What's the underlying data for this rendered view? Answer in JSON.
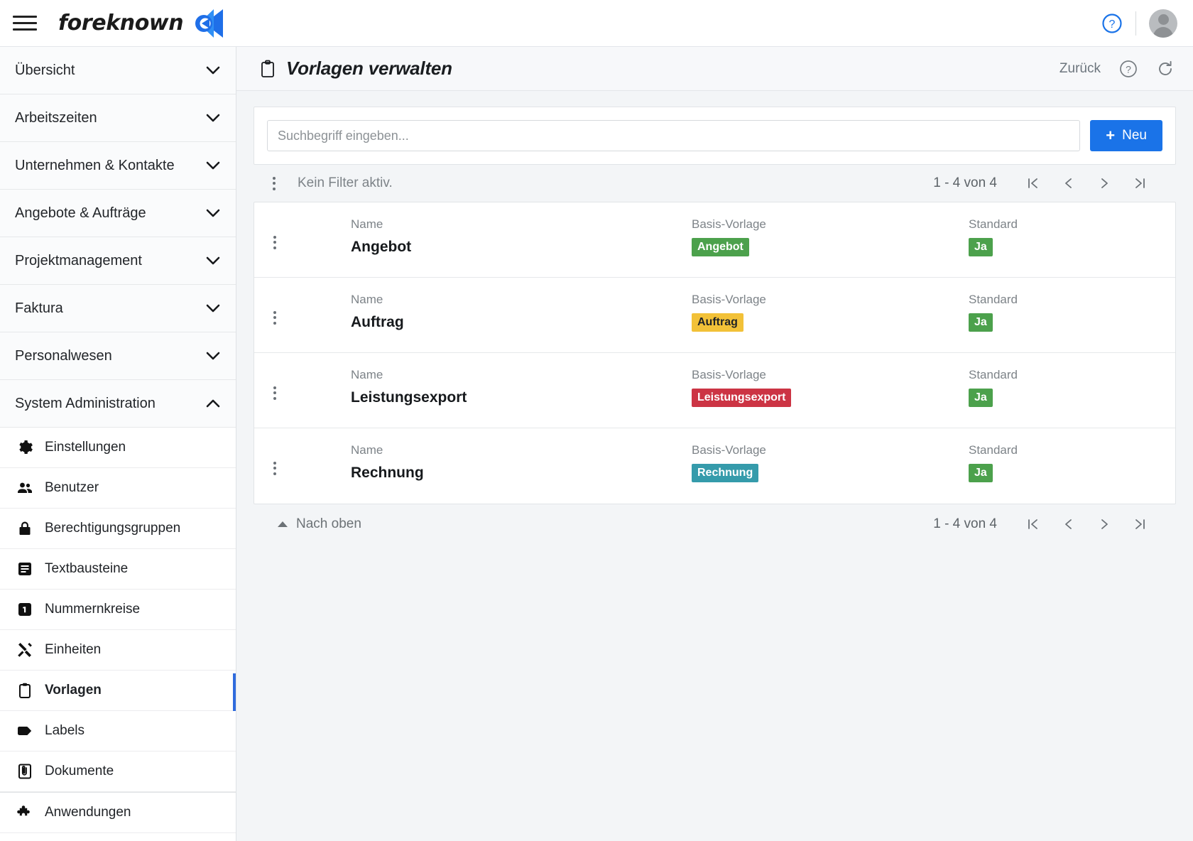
{
  "topbar": {
    "menu_icon": "hamburger-menu-icon",
    "brand_name": "foreknown",
    "brand_mark_icon": "foreknown-logo-icon",
    "help_icon": "help-circle-icon",
    "avatar_icon": "user-avatar-icon"
  },
  "sidebar": {
    "groups": [
      {
        "label": "Übersicht",
        "icon": "chevron-down-icon",
        "expanded": false
      },
      {
        "label": "Arbeitszeiten",
        "icon": "chevron-down-icon",
        "expanded": false
      },
      {
        "label": "Unternehmen & Kontakte",
        "icon": "chevron-down-icon",
        "expanded": false
      },
      {
        "label": "Angebote & Aufträge",
        "icon": "chevron-down-icon",
        "expanded": false
      },
      {
        "label": "Projektmanagement",
        "icon": "chevron-down-icon",
        "expanded": false
      },
      {
        "label": "Faktura",
        "icon": "chevron-down-icon",
        "expanded": false
      },
      {
        "label": "Personalwesen",
        "icon": "chevron-down-icon",
        "expanded": false
      },
      {
        "label": "System Administration",
        "icon": "chevron-up-icon",
        "expanded": true
      }
    ],
    "items": [
      {
        "label": "Einstellungen",
        "icon": "gear-icon",
        "active": false
      },
      {
        "label": "Benutzer",
        "icon": "people-icon",
        "active": false
      },
      {
        "label": "Berechtigungsgruppen",
        "icon": "lock-icon",
        "active": false
      },
      {
        "label": "Textbausteine",
        "icon": "text-block-icon",
        "active": false
      },
      {
        "label": "Nummernkreise",
        "icon": "number-one-box-icon",
        "active": false
      },
      {
        "label": "Einheiten",
        "icon": "tools-icon",
        "active": false
      },
      {
        "label": "Vorlagen",
        "icon": "clipboard-icon",
        "active": true
      },
      {
        "label": "Labels",
        "icon": "tag-icon",
        "active": false
      },
      {
        "label": "Dokumente",
        "icon": "document-attachment-icon",
        "active": false
      },
      {
        "label": "Anwendungen",
        "icon": "puzzle-piece-icon",
        "active": false
      }
    ],
    "active_marker_color": "#2f6bdd"
  },
  "page_header": {
    "icon": "clipboard-icon",
    "title": "Vorlagen verwalten",
    "back_label": "Zurück",
    "help_icon": "help-circle-outline-icon",
    "refresh_icon": "refresh-icon"
  },
  "search": {
    "placeholder": "Suchbegriff eingeben...",
    "value": "",
    "new_button_label": "Neu",
    "new_button_icon": "plus-icon",
    "new_button_color": "#1a73e8"
  },
  "filterbar": {
    "options_icon": "kebab-menu-icon",
    "filter_text": "Kein Filter aktiv.",
    "pager": {
      "count_label": "1 - 4 von 4",
      "first_icon": "first-page-icon",
      "prev_icon": "prev-page-icon",
      "next_icon": "next-page-icon",
      "last_icon": "last-page-icon"
    }
  },
  "table": {
    "columns": [
      "Name",
      "Basis-Vorlage",
      "Standard"
    ],
    "rows": [
      {
        "row_menu_icon": "kebab-menu-icon",
        "name_label": "Name",
        "name": "Angebot",
        "basis_label": "Basis-Vorlage",
        "basis": "Angebot",
        "basis_color": "#4ca14c",
        "basis_text_color": "#ffffff",
        "standard_label": "Standard",
        "standard": "Ja",
        "standard_color": "#4ca14c",
        "standard_text_color": "#ffffff"
      },
      {
        "row_menu_icon": "kebab-menu-icon",
        "name_label": "Name",
        "name": "Auftrag",
        "basis_label": "Basis-Vorlage",
        "basis": "Auftrag",
        "basis_color": "#f2c138",
        "basis_text_color": "#1f2226",
        "standard_label": "Standard",
        "standard": "Ja",
        "standard_color": "#4ca14c",
        "standard_text_color": "#ffffff"
      },
      {
        "row_menu_icon": "kebab-menu-icon",
        "name_label": "Name",
        "name": "Leistungsexport",
        "basis_label": "Basis-Vorlage",
        "basis": "Leistungsexport",
        "basis_color": "#cc3444",
        "basis_text_color": "#ffffff",
        "standard_label": "Standard",
        "standard": "Ja",
        "standard_color": "#4ca14c",
        "standard_text_color": "#ffffff"
      },
      {
        "row_menu_icon": "kebab-menu-icon",
        "name_label": "Name",
        "name": "Rechnung",
        "basis_label": "Basis-Vorlage",
        "basis": "Rechnung",
        "basis_color": "#359bab",
        "basis_text_color": "#ffffff",
        "standard_label": "Standard",
        "standard": "Ja",
        "standard_color": "#4ca14c",
        "standard_text_color": "#ffffff"
      }
    ]
  },
  "footer": {
    "to_top_label": "Nach oben",
    "to_top_icon": "caret-up-icon",
    "pager": {
      "count_label": "1 - 4 von 4",
      "first_icon": "first-page-icon",
      "prev_icon": "prev-page-icon",
      "next_icon": "next-page-icon",
      "last_icon": "last-page-icon"
    }
  }
}
